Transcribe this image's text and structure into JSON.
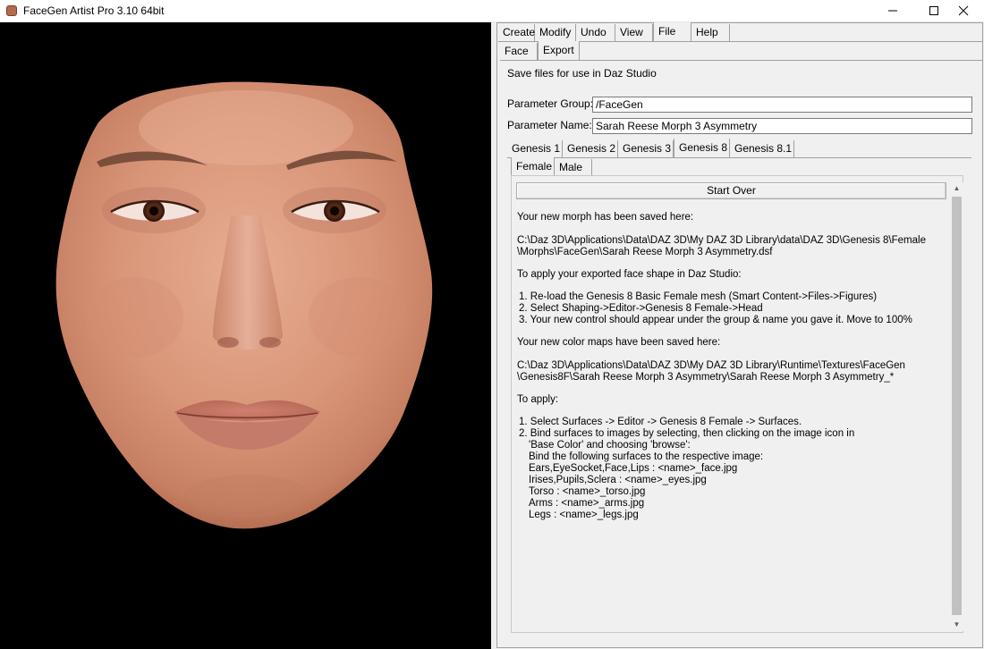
{
  "window": {
    "title": "FaceGen Artist Pro 3.10 64bit"
  },
  "menu_tabs": [
    {
      "label": "Create"
    },
    {
      "label": "Modify"
    },
    {
      "label": "Undo"
    },
    {
      "label": "View"
    },
    {
      "label": "File"
    },
    {
      "label": "Help"
    }
  ],
  "file_tabs": [
    {
      "label": "Face"
    },
    {
      "label": "Export"
    }
  ],
  "export": {
    "heading": "Save files for use in Daz Studio",
    "param_group_label": "Parameter Group:",
    "param_group_value": "/FaceGen",
    "param_name_label": "Parameter Name:",
    "param_name_value": "Sarah Reese Morph 3 Asymmetry"
  },
  "genesis_tabs": [
    {
      "label": "Genesis 1"
    },
    {
      "label": "Genesis 2"
    },
    {
      "label": "Genesis 3"
    },
    {
      "label": "Genesis 8"
    },
    {
      "label": "Genesis 8.1"
    }
  ],
  "gender_tabs": [
    {
      "label": "Female"
    },
    {
      "label": "Male"
    }
  ],
  "start_over_label": "Start Over",
  "message": {
    "saved_heading": "Your new morph has been saved here:",
    "morph_path_1": "C:\\Daz 3D\\Applications\\Data\\DAZ 3D\\My DAZ 3D Library\\data\\DAZ 3D\\Genesis 8\\Female",
    "morph_path_2": "\\Morphs\\FaceGen\\Sarah Reese Morph 3 Asymmetry.dsf",
    "apply_heading": "To apply your exported face shape in Daz Studio:",
    "step1": "1. Re-load the Genesis 8 Basic Female mesh (Smart Content->Files->Figures)",
    "step2": "2. Select Shaping->Editor->Genesis 8 Female->Head",
    "step3": "3. Your new control should appear under the group & name you gave it. Move to 100%",
    "color_heading": "Your new color maps have been saved here:",
    "color_path_1": "C:\\Daz 3D\\Applications\\Data\\DAZ 3D\\My DAZ 3D Library\\Runtime\\Textures\\FaceGen",
    "color_path_2": "\\Genesis8F\\Sarah Reese Morph 3 Asymmetry\\Sarah Reese Morph 3 Asymmetry_*",
    "to_apply": "To apply:",
    "astep1": "1. Select Surfaces -> Editor -> Genesis 8 Female -> Surfaces.",
    "astep2a": "2. Bind surfaces to images by selecting, then clicking on the image icon in",
    "astep2b": "'Base Color' and choosing 'browse':",
    "astep2c": "Bind the following surfaces to the respective image:",
    "map1": "Ears,EyeSocket,Face,Lips : <name>_face.jpg",
    "map2": "Irises,Pupils,Sclera : <name>_eyes.jpg",
    "map3": "Torso : <name>_torso.jpg",
    "map4": "Arms : <name>_arms.jpg",
    "map5": "Legs : <name>_legs.jpg"
  },
  "colors": {
    "viewport_bg": "#000000",
    "panel_bg": "#f0f0f0",
    "skin": "#d9977a"
  }
}
